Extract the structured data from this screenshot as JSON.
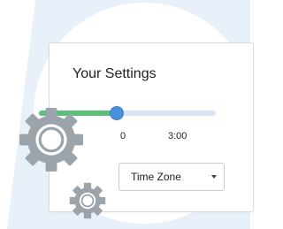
{
  "settings": {
    "title": "Your Settings",
    "slider": {
      "min_label": "0",
      "value_label": "3:00",
      "level": 0.44
    },
    "time_zone": {
      "selected": "Time Zone"
    }
  },
  "colors": {
    "background_stripe": "#e8f1fa",
    "track": "#d6e6f4",
    "track_fill": "#5cbe7a",
    "thumb": "#4a90d9",
    "gear": "#9ba3ab"
  },
  "icons": {
    "large_gear": "gear-icon",
    "small_gear": "gear-icon"
  }
}
